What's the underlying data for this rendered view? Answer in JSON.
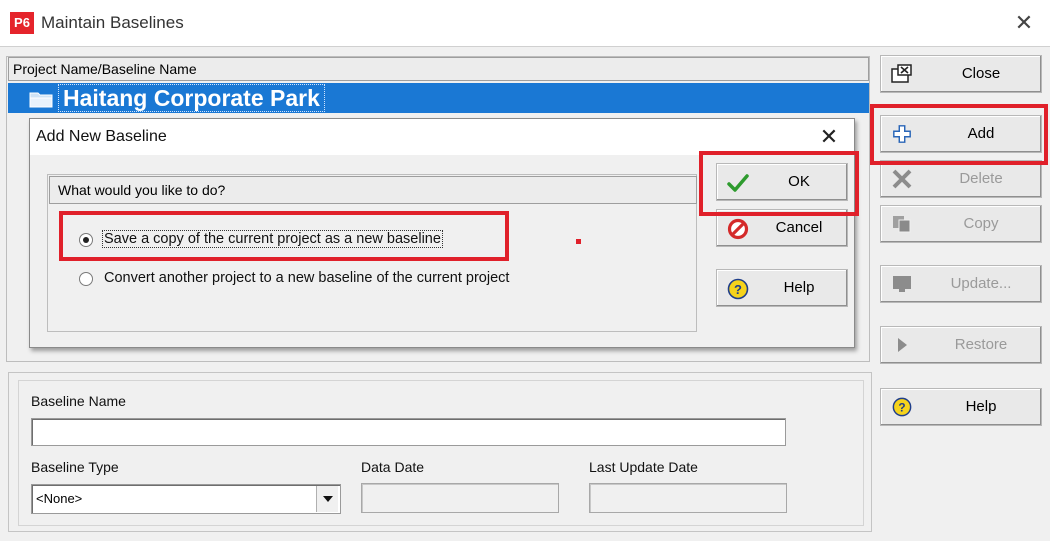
{
  "window": {
    "app_logo": "P6",
    "title": "Maintain Baselines",
    "close_glyph": "✕"
  },
  "grid": {
    "column_header": "Project Name/Baseline Name",
    "rows": [
      {
        "name": "Haitang Corporate Park",
        "icon": "folder-icon",
        "selected": true
      }
    ]
  },
  "side_buttons": {
    "close": {
      "label": "Close",
      "icon": "close-window-icon",
      "enabled": true
    },
    "add": {
      "label": "Add",
      "icon": "plus-icon",
      "enabled": true
    },
    "delete": {
      "label": "Delete",
      "icon": "x-mark-icon",
      "enabled": false
    },
    "copy": {
      "label": "Copy",
      "icon": "copy-icon",
      "enabled": false
    },
    "update": {
      "label": "Update...",
      "icon": "monitor-icon",
      "enabled": false
    },
    "restore": {
      "label": "Restore",
      "icon": "play-triangle-icon",
      "enabled": false
    },
    "help": {
      "label": "Help",
      "icon": "question-icon",
      "enabled": true
    }
  },
  "details": {
    "baseline_name_label": "Baseline Name",
    "baseline_name_value": "",
    "baseline_type_label": "Baseline Type",
    "baseline_type_value": "<None>",
    "data_date_label": "Data Date",
    "data_date_value": "",
    "last_update_label": "Last Update Date",
    "last_update_value": ""
  },
  "modal": {
    "title": "Add New Baseline",
    "close_glyph": "✕",
    "group_header": "What would you like to do?",
    "options": [
      {
        "label": "Save a copy of the current project as a new baseline",
        "selected": true
      },
      {
        "label": "Convert another project to a new baseline of the current project",
        "selected": false
      }
    ],
    "ok_label": "OK",
    "cancel_label": "Cancel",
    "help_label": "Help"
  },
  "colors": {
    "selection": "#1a78d4",
    "highlight": "#e0202a",
    "logo": "#e5242b",
    "ok_check": "#2e9b2e",
    "cancel_red": "#d42a2a",
    "help_yellow": "#f5d31c"
  }
}
